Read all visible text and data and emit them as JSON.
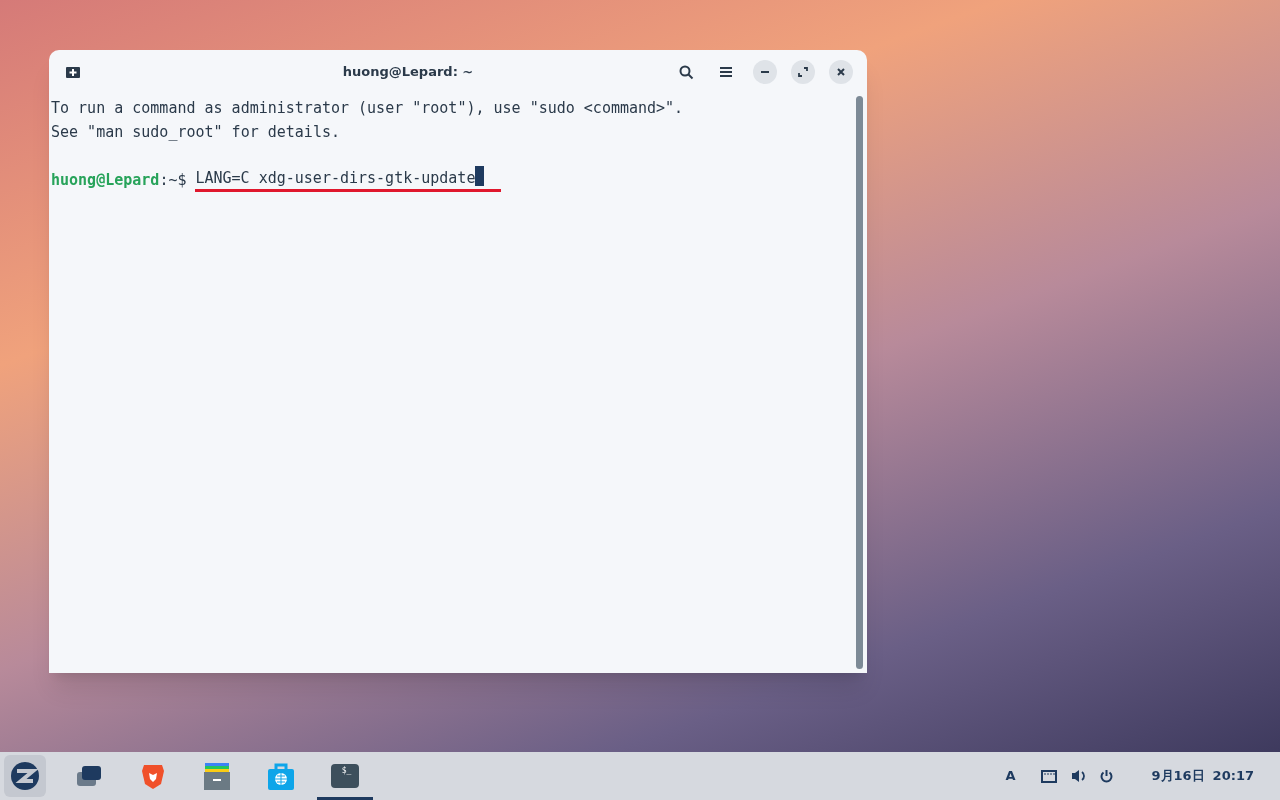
{
  "window": {
    "title": "huong@Lepard: ~"
  },
  "terminal": {
    "lines": [
      {
        "kind": "output",
        "text": "To run a command as administrator (user \"root\"), use \"sudo <command>\"."
      },
      {
        "kind": "output",
        "text": "See \"man sudo_root\" for details."
      },
      {
        "kind": "blank"
      },
      {
        "kind": "prompt",
        "user_host": "huong@Lepard",
        "path": ":~$",
        "command": "LANG=C xdg-user-dirs-gtk-update",
        "underlined": true,
        "cursor": true
      }
    ]
  },
  "taskbar": {
    "launchers": [
      {
        "kind": "menu",
        "selected": true
      },
      {
        "kind": "windows",
        "selected": false
      },
      {
        "kind": "browser",
        "selected": false
      },
      {
        "kind": "files",
        "selected": false
      },
      {
        "kind": "store",
        "selected": false
      },
      {
        "kind": "terminal",
        "glyph": "$_",
        "selected": false,
        "running": true
      }
    ],
    "keyboard_layout": "A",
    "date": "9月16日",
    "time": "20:17"
  }
}
